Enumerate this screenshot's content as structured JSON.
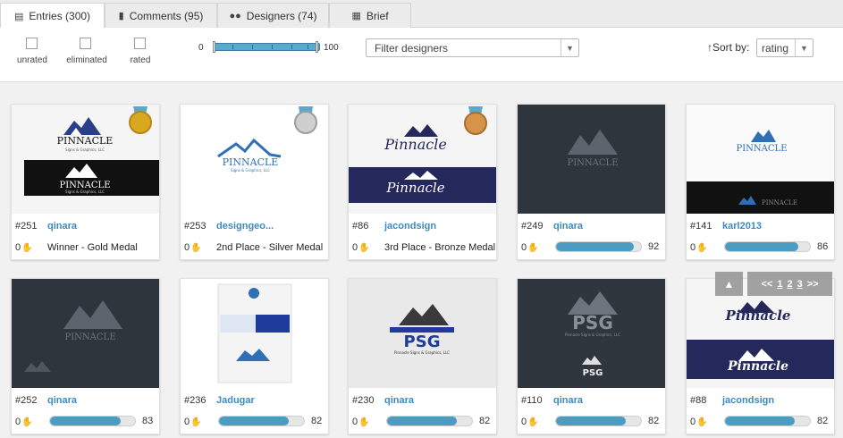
{
  "tabs": [
    {
      "label": "Entries (300)",
      "icon": "entries-icon"
    },
    {
      "label": "Comments (95)",
      "icon": "comments-icon"
    },
    {
      "label": "Designers (74)",
      "icon": "designers-icon"
    },
    {
      "label": "Brief",
      "icon": "book-icon"
    }
  ],
  "filters": {
    "checkboxes": [
      "unrated",
      "eliminated",
      "rated"
    ],
    "range_min": "0",
    "range_max": "100",
    "designer_placeholder": "Filter designers",
    "sort_label": "Sort by:",
    "sort_value": "rating"
  },
  "entries": [
    {
      "num": "#251",
      "author": "qinara",
      "likes": "0",
      "status": "Winner - Gold Medal",
      "medal": "gold"
    },
    {
      "num": "#253",
      "author": "designgeo...",
      "likes": "0",
      "status": "2nd Place - Silver Medal",
      "medal": "silver"
    },
    {
      "num": "#86",
      "author": "jacondsign",
      "likes": "0",
      "status": "3rd Place - Bronze Medal",
      "medal": "bronze"
    },
    {
      "num": "#249",
      "author": "qinara",
      "likes": "0",
      "score": "92",
      "rating": 0.92
    },
    {
      "num": "#141",
      "author": "karl2013",
      "likes": "0",
      "score": "86",
      "rating": 0.86
    },
    {
      "num": "#252",
      "author": "qinara",
      "likes": "0",
      "score": "83",
      "rating": 0.83
    },
    {
      "num": "#236",
      "author": "Jadugar",
      "likes": "0",
      "score": "82",
      "rating": 0.82
    },
    {
      "num": "#230",
      "author": "qinara",
      "likes": "0",
      "score": "82",
      "rating": 0.82
    },
    {
      "num": "#110",
      "author": "qinara",
      "likes": "0",
      "score": "82",
      "rating": 0.82
    },
    {
      "num": "#88",
      "author": "jacondsign",
      "likes": "0",
      "score": "82",
      "rating": 0.82
    }
  ],
  "logos": {
    "pinnacle": "PINNACLE",
    "pinnacle_sub": "Signs & Graphics, LLC",
    "pinnacle_script": "Pinnacle",
    "psg": "PSG",
    "psg_sub": "Pinnacle Signs & Graphics, LLC"
  },
  "pager": {
    "prev": "<<",
    "pages": [
      "1",
      "2",
      "3"
    ],
    "next": ">>"
  },
  "colors": {
    "accent": "#3b8ac2",
    "bar": "#4b9bc2",
    "navy": "#24285a"
  }
}
